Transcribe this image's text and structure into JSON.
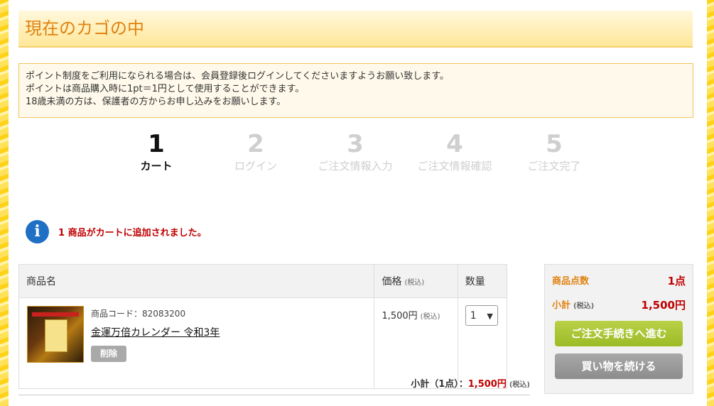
{
  "page_title": "現在のカゴの中",
  "notice": {
    "lines": [
      "ポイント制度をご利用になられる場合は、会員登録後ログインしてくださいますようお願い致します。",
      "ポイントは商品購入時に1pt＝1円として使用することができます。",
      "18歳未満の方は、保護者の方からお申し込みをお願いします。"
    ]
  },
  "steps": [
    {
      "num": "1",
      "label": "カート"
    },
    {
      "num": "2",
      "label": "ログイン"
    },
    {
      "num": "3",
      "label": "ご注文情報入力"
    },
    {
      "num": "4",
      "label": "ご注文情報確認"
    },
    {
      "num": "5",
      "label": "ご注文完了"
    }
  ],
  "active_step": 1,
  "message": "1 商品がカートに追加されました。",
  "table": {
    "col_name": "商品名",
    "col_price": "価格",
    "col_qty": "数量",
    "tax_label": "(税込)"
  },
  "item": {
    "code": "商品コード：82083200",
    "name": "金運万倍カレンダー 令和3年",
    "delete_label": "削除",
    "price": "1,500円",
    "price_tax": "(税込)",
    "qty": "1"
  },
  "subtotal": {
    "label": "小計（1点）：",
    "amount": "1,500円",
    "tax": "(税込)"
  },
  "summary": {
    "count_label": "商品点数",
    "count_value": "1点",
    "subtotal_label": "小計",
    "subtotal_tax": "(税込)",
    "subtotal_value": "1,500円",
    "checkout_button": "ご注文手続きへ進む",
    "continue_button": "買い物を続ける"
  },
  "colors": {
    "accent_orange": "#e0820f",
    "price_red": "#c00000",
    "checkout_green": "#9cbb25",
    "info_blue": "#1f6fc4",
    "background_yellow": "#ffe259"
  }
}
